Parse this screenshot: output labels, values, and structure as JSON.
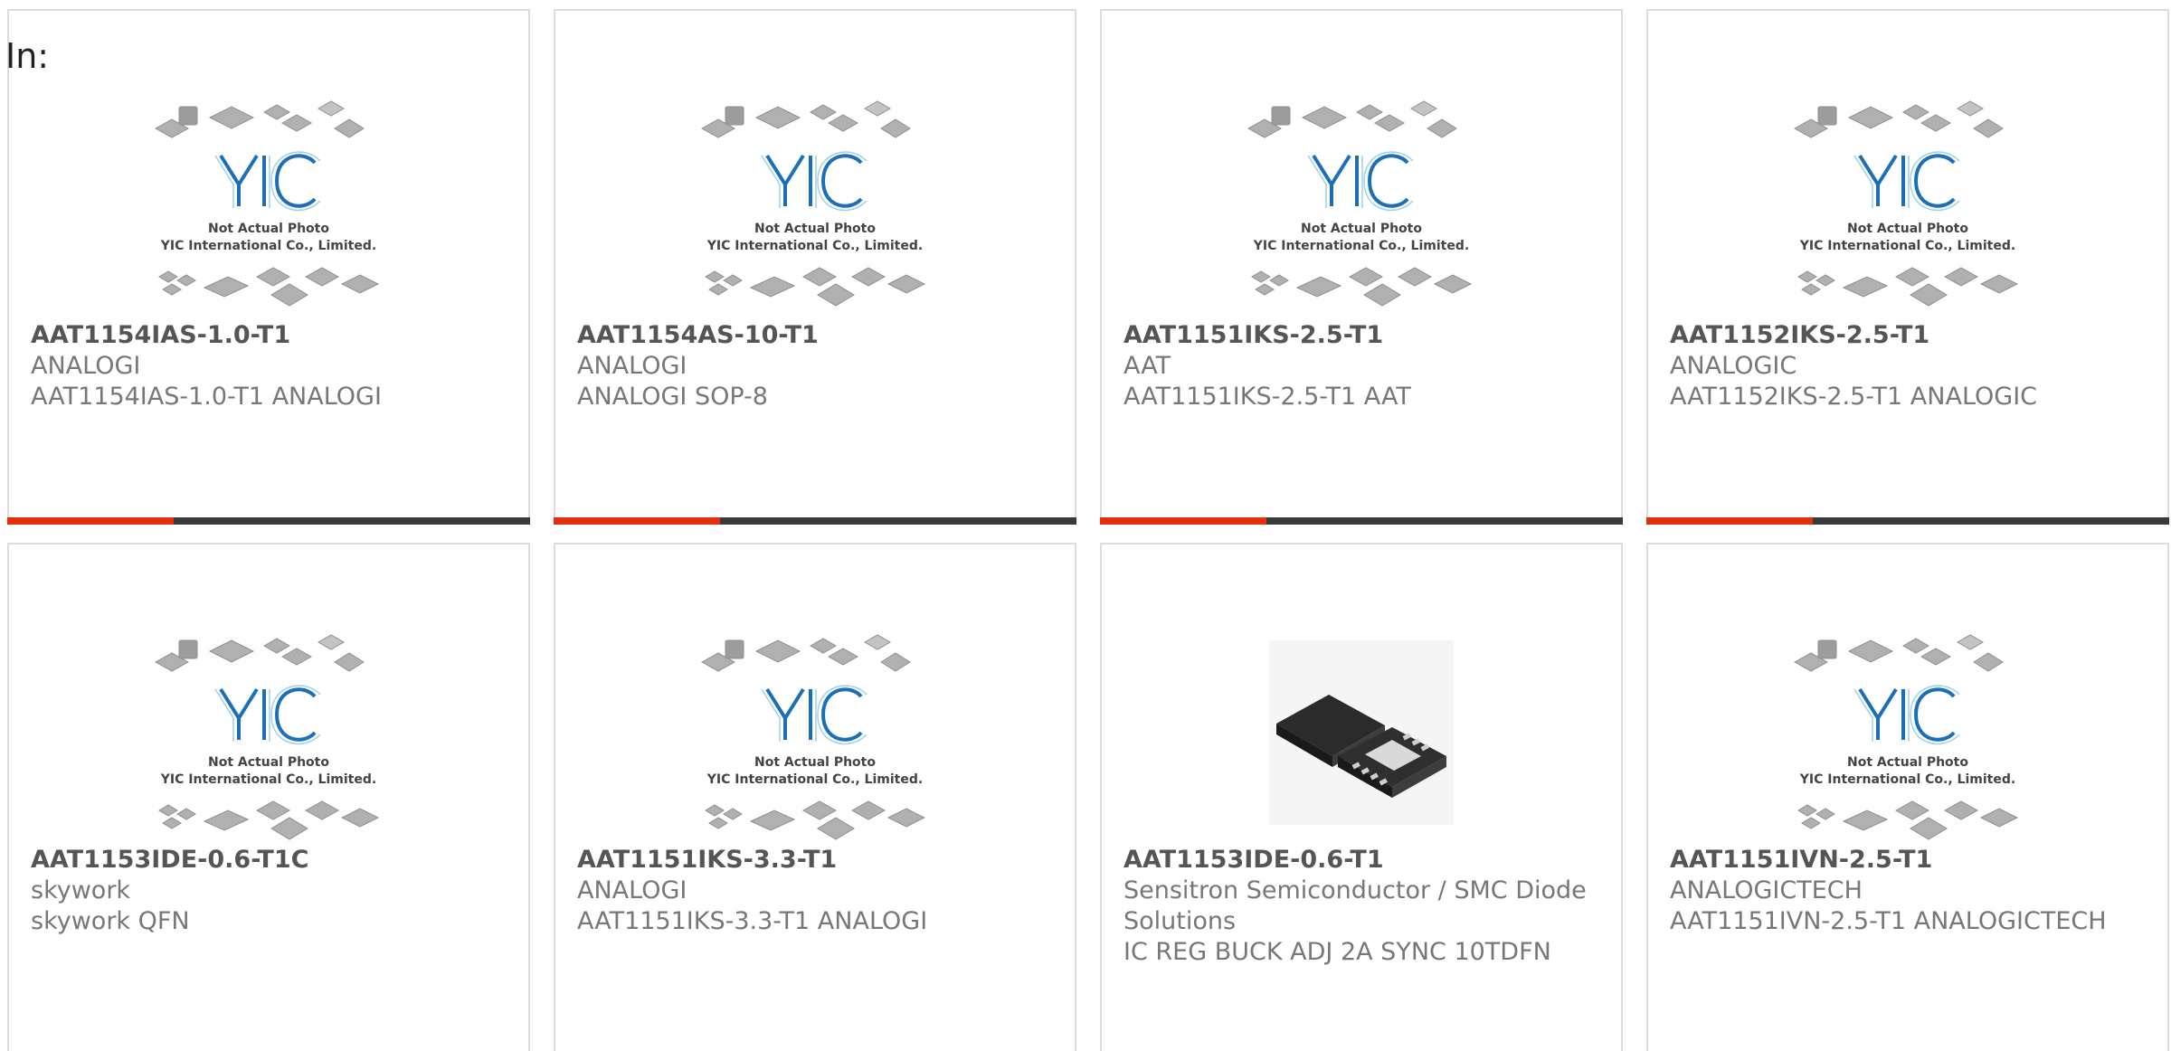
{
  "header": {
    "in_label": "In:"
  },
  "placeholder_image": {
    "line1": "Not Actual Photo",
    "line2": "YIC International Co., Limited.",
    "logo_text": "YIC"
  },
  "colors": {
    "accent": "#e0300e",
    "bar": "#3a3a3a",
    "logo_blue": "#1a6fb8",
    "chip_gray": "#a9a9a9"
  },
  "products": [
    {
      "part_number": "AAT1154IAS-1.0-T1",
      "manufacturer": "ANALOGI",
      "description": "AAT1154IAS-1.0-T1 ANALOGI",
      "image": "yic-placeholder"
    },
    {
      "part_number": "AAT1154AS-10-T1",
      "manufacturer": "ANALOGI",
      "description": "ANALOGI SOP-8",
      "image": "yic-placeholder"
    },
    {
      "part_number": "AAT1151IKS-2.5-T1",
      "manufacturer": "AAT",
      "description": "AAT1151IKS-2.5-T1 AAT",
      "image": "yic-placeholder"
    },
    {
      "part_number": "AAT1152IKS-2.5-T1",
      "manufacturer": "ANALOGIC",
      "description": "AAT1152IKS-2.5-T1 ANALOGIC",
      "image": "yic-placeholder"
    },
    {
      "part_number": "AAT1153IDE-0.6-T1C",
      "manufacturer": "skywork",
      "description": "skywork QFN",
      "image": "yic-placeholder"
    },
    {
      "part_number": "AAT1151IKS-3.3-T1",
      "manufacturer": "ANALOGI",
      "description": "AAT1151IKS-3.3-T1 ANALOGI",
      "image": "yic-placeholder"
    },
    {
      "part_number": "AAT1153IDE-0.6-T1",
      "manufacturer": "Sensitron Semiconductor / SMC Diode Solutions",
      "description": "IC REG BUCK ADJ 2A SYNC 10TDFN",
      "image": "tdfn-chip-photo"
    },
    {
      "part_number": "AAT1151IVN-2.5-T1",
      "manufacturer": "ANALOGICTECH",
      "description": "AAT1151IVN-2.5-T1 ANALOGICTECH",
      "image": "yic-placeholder"
    }
  ]
}
